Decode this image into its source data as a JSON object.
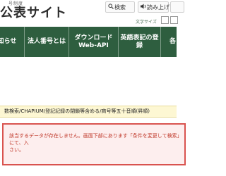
{
  "header": {
    "site_subtitle": "号制度",
    "site_title": "公表サイト",
    "search_btn": "検索",
    "read_btn": "読み上げ",
    "extra_btn": "",
    "fontsize_label": "文字サイズ"
  },
  "nav": {
    "items": [
      {
        "label": "知らせ"
      },
      {
        "label": "法人番号とは"
      },
      {
        "label": "ダウンロード\nWeb-API"
      },
      {
        "label": "英語表記の登録"
      },
      {
        "label": "各"
      }
    ]
  },
  "results": {
    "query_text": "数検索/CHAPIUM/登記記録の閉鎖等含める/商号等五十音順(昇順)",
    "message": "該当するデータが存在しません。画面下部にあります「条件を変更して検索」にて、入\nさい。"
  },
  "colors": {
    "nav_bg": "#2e5e3f",
    "query_bg": "#fdf7d3",
    "error_border": "#d9534f",
    "error_bg": "#fdeeee",
    "error_text": "#c0392b"
  },
  "icons": {
    "search": "magnifier-icon",
    "speaker": "speaker-icon"
  }
}
